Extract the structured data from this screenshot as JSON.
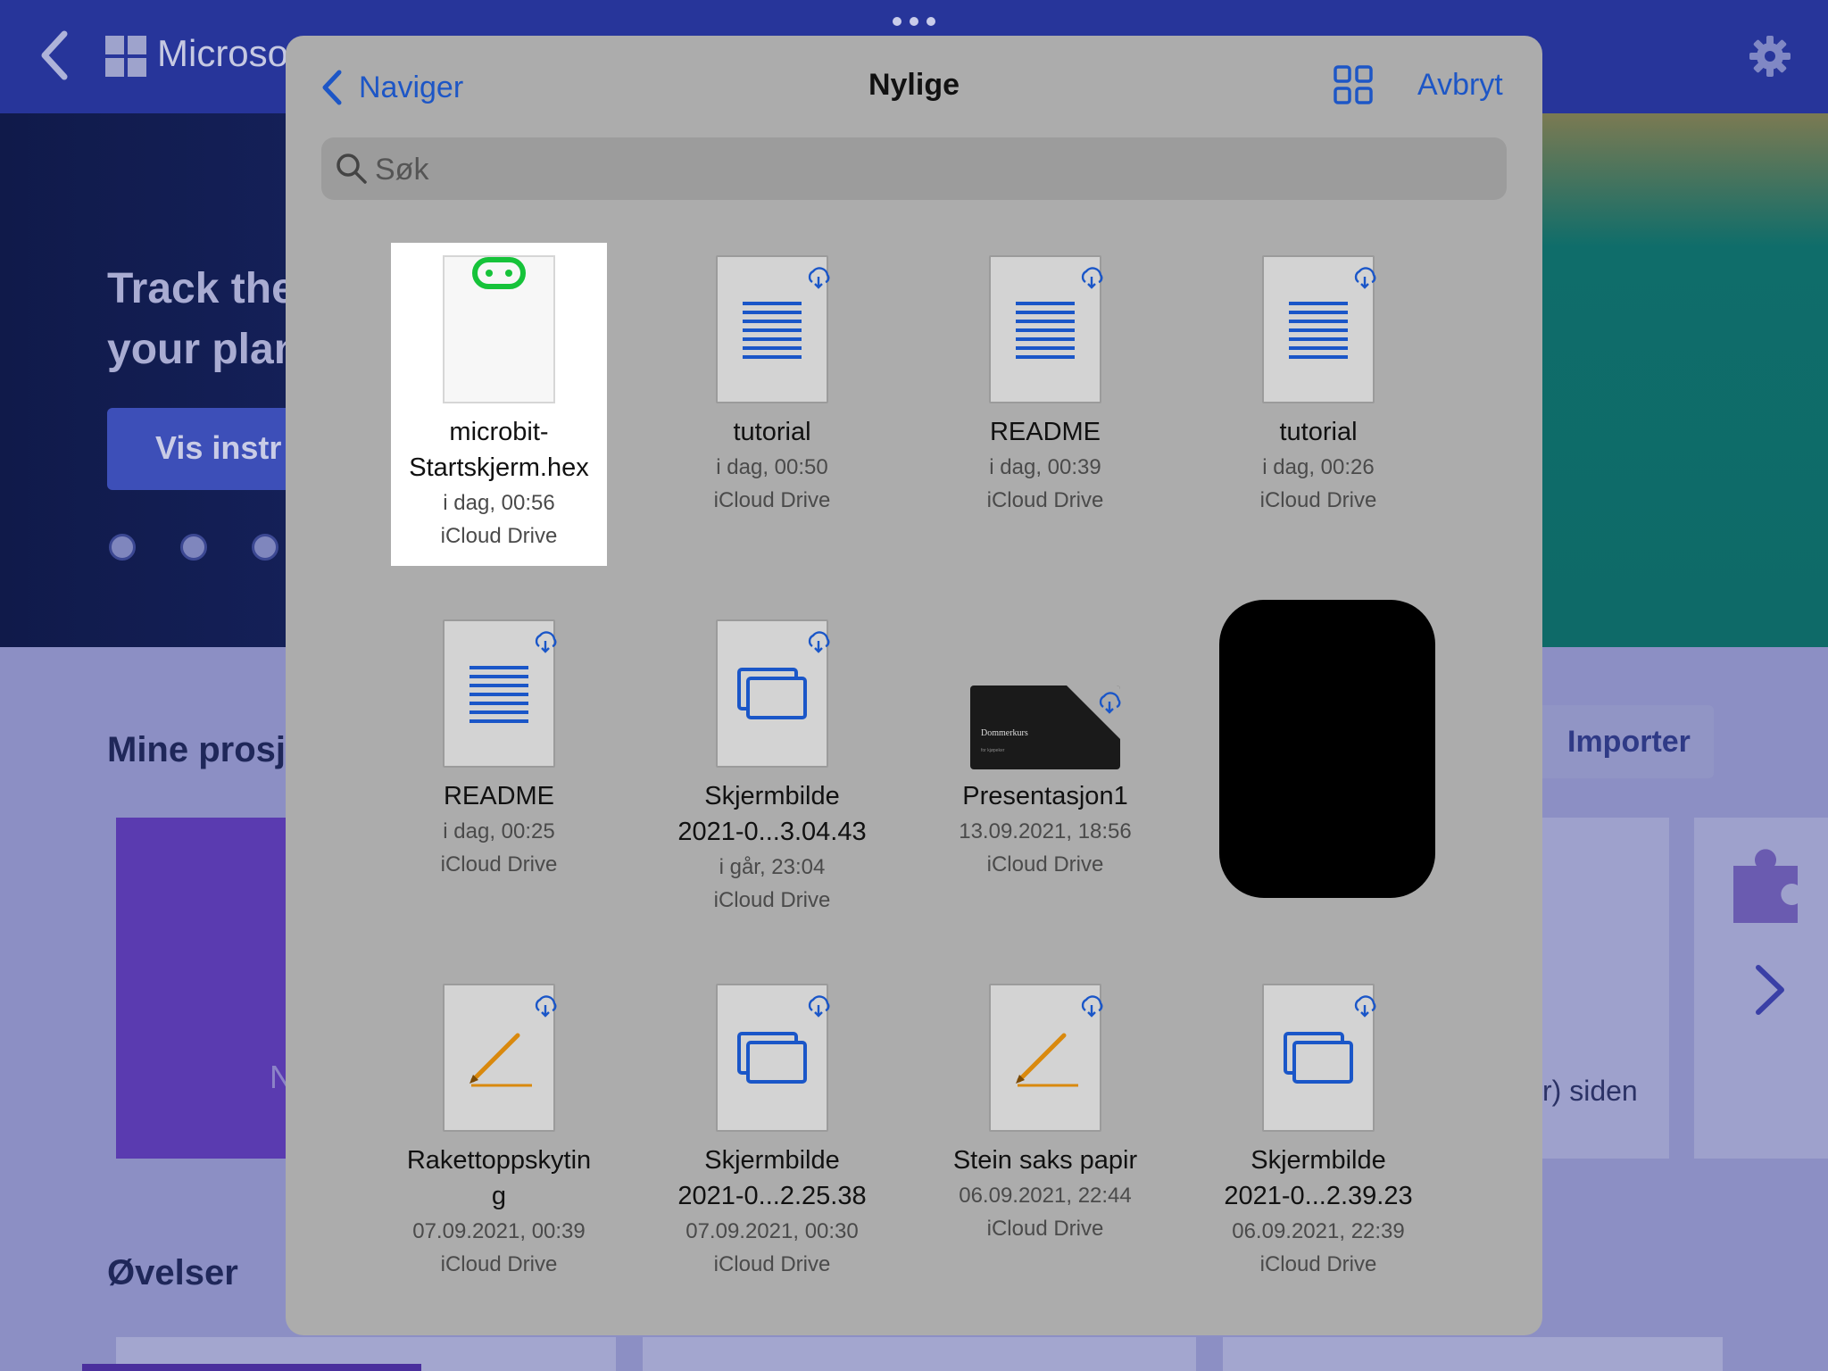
{
  "background": {
    "logo_text": "Microsoft",
    "hero_title_line1": "Track the",
    "hero_title_line2": "your plan",
    "hero_button": "Vis instr",
    "section_projects": "Mine prosj",
    "project_card_letter": "N",
    "import_button": "Importer",
    "card_caption": "r) siden",
    "section_exercises": "Øvelser"
  },
  "sheet": {
    "back_label": "Naviger",
    "title": "Nylige",
    "cancel_label": "Avbryt",
    "search_placeholder": "Søk"
  },
  "files": [
    {
      "name_line1": "microbit-",
      "name_line2": "Startskjerm.hex",
      "date": "i dag, 00:56",
      "location": "iCloud Drive",
      "icon": "microbit-hex-icon",
      "selected": true
    },
    {
      "name_line1": "tutorial",
      "date": "i dag, 00:50",
      "location": "iCloud Drive",
      "icon": "text-document-icon"
    },
    {
      "name_line1": "README",
      "date": "i dag, 00:39",
      "location": "iCloud Drive",
      "icon": "text-document-icon"
    },
    {
      "name_line1": "tutorial",
      "date": "i dag, 00:26",
      "location": "iCloud Drive",
      "icon": "text-document-icon"
    },
    {
      "name_line1": "README",
      "date": "i dag, 00:25",
      "location": "iCloud Drive",
      "icon": "text-document-icon"
    },
    {
      "name_line1": "Skjermbilde",
      "name_line2": "2021-0...3.04.43",
      "date": "i går, 23:04",
      "location": "iCloud Drive",
      "icon": "image-stack-icon"
    },
    {
      "name_line1": "Presentasjon1",
      "date": "13.09.2021, 18:56",
      "location": "iCloud Drive",
      "icon": "presentation-thumbnail",
      "thumb_title": "Dommerkurs",
      "thumb_subtitle": "for kjøpeker"
    },
    {
      "name_line1": "",
      "icon": "redacted"
    },
    {
      "name_line1": "Rakettoppskytin",
      "name_line2": "g",
      "date": "07.09.2021, 00:39",
      "location": "iCloud Drive",
      "icon": "pencil-drawing-icon"
    },
    {
      "name_line1": "Skjermbilde",
      "name_line2": "2021-0...2.25.38",
      "date": "07.09.2021, 00:30",
      "location": "iCloud Drive",
      "icon": "image-stack-icon"
    },
    {
      "name_line1": "Stein saks papir",
      "date": "06.09.2021, 22:44",
      "location": "iCloud Drive",
      "icon": "pencil-drawing-icon"
    },
    {
      "name_line1": "Skjermbilde",
      "name_line2": "2021-0...2.39.23",
      "date": "06.09.2021, 22:39",
      "location": "iCloud Drive",
      "icon": "image-stack-icon"
    }
  ],
  "colors": {
    "accent": "#1d56c6",
    "sheet": "#acacac",
    "icon_blue": "#1a56c8",
    "icon_orange": "#d9890e",
    "microbit_green": "#16c33a"
  }
}
